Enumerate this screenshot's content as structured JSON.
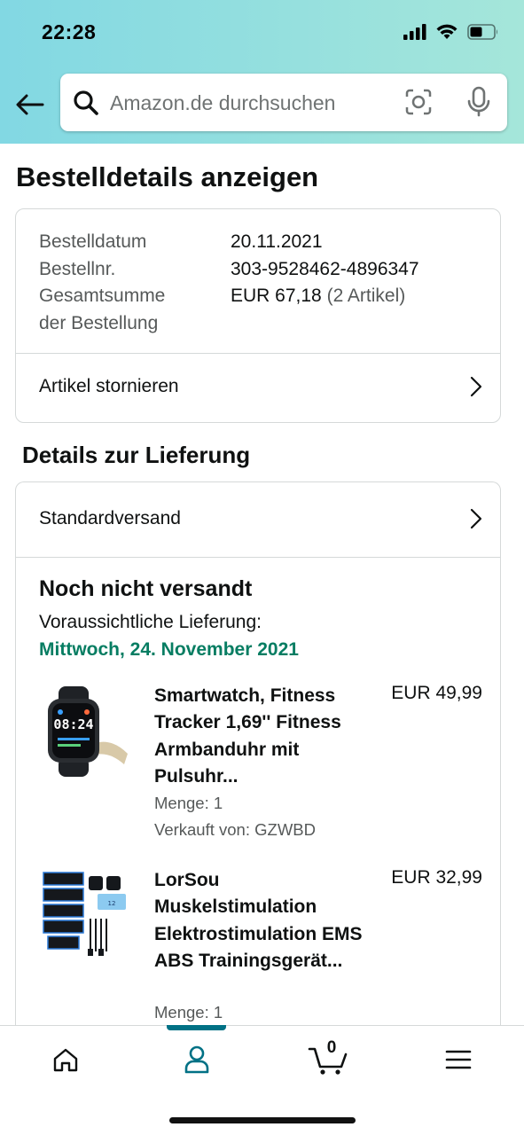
{
  "status_bar": {
    "time": "22:28"
  },
  "search": {
    "placeholder": "Amazon.de durchsuchen"
  },
  "page": {
    "title": "Bestelldetails anzeigen"
  },
  "order_summary": {
    "date_label": "Bestelldatum",
    "date_value": "20.11.2021",
    "number_label": "Bestellnr.",
    "number_value": "303-9528462-4896347",
    "total_label_line1": "Gesamtsumme",
    "total_label_line2": "der Bestellung",
    "total_value": "EUR 67,18",
    "total_items": "(2 Artikel)",
    "cancel_label": "Artikel stornieren"
  },
  "delivery": {
    "section_title": "Details zur Lieferung",
    "shipping_method": "Standardversand",
    "status": "Noch nicht versandt",
    "eta_label": "Voraussichtliche Lieferung:",
    "eta_date": "Mittwoch, 24. November 2021",
    "items": [
      {
        "title": "Smartwatch, Fitness Tracker 1,69'' Fitness Armbanduhr mit Pulsuhr...",
        "price": "EUR 49,99",
        "quantity": "Menge: 1",
        "seller": "Verkauft von: GZWBD",
        "image_icon": "smartwatch-image"
      },
      {
        "title": "LorSou Muskelstimulation Elektrostimulation EMS ABS Trainingsgerät...",
        "price": "EUR 32,99",
        "quantity": "Menge: 1",
        "image_icon": "ems-trainer-image"
      }
    ]
  },
  "bottom_nav": {
    "cart_count": "0",
    "items": [
      "home-icon",
      "account-icon",
      "cart-icon",
      "menu-icon"
    ],
    "active": "account-icon",
    "accent_color": "#007185"
  },
  "colors": {
    "header_gradient_start": "#82d8e3",
    "header_gradient_end": "#a5e6da",
    "eta_green": "#067d62"
  }
}
